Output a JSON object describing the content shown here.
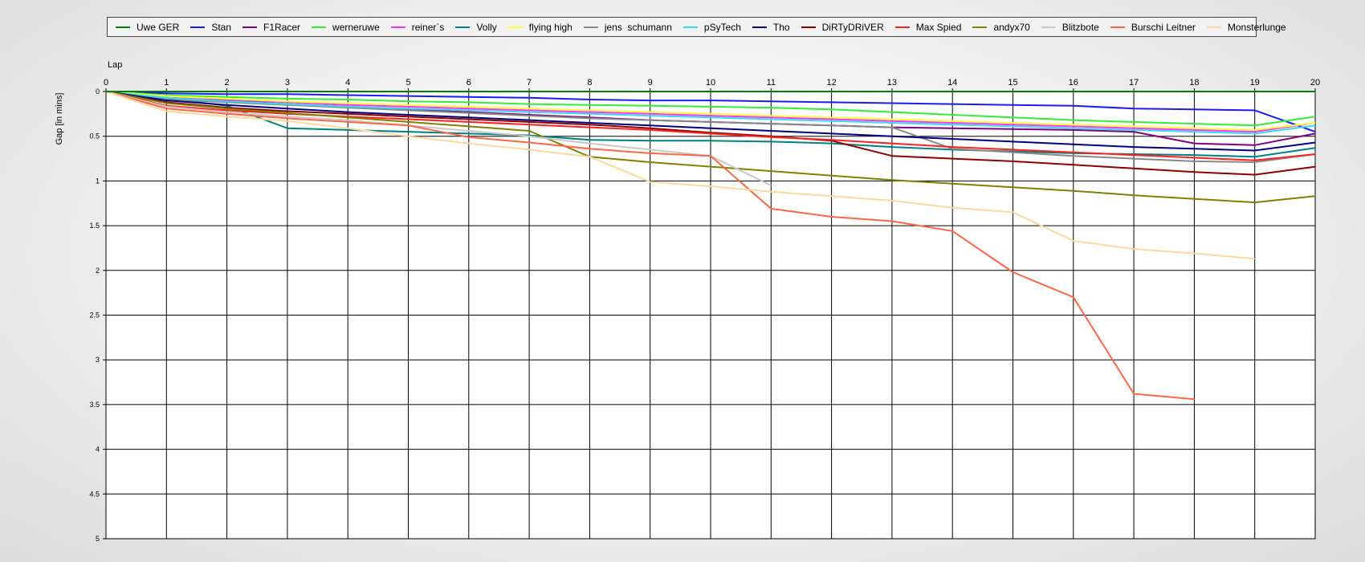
{
  "chart_data": {
    "type": "line",
    "xlabel": "Lap",
    "ylabel": "Gap [in mins]",
    "xlim": [
      0,
      20
    ],
    "ylim": [
      0,
      5
    ],
    "x_ticks": [
      "0",
      "1",
      "2",
      "3",
      "4",
      "5",
      "6",
      "7",
      "8",
      "9",
      "10",
      "11",
      "12",
      "13",
      "14",
      "15",
      "16",
      "17",
      "18",
      "19",
      "20"
    ],
    "y_ticks": [
      "0",
      "0.5",
      "1",
      "1.5",
      "2",
      "2.5",
      "3",
      "3.5",
      "4",
      "4.5",
      "5"
    ],
    "grid": true,
    "y_inverted": true,
    "legend_position": "top",
    "series": [
      {
        "name": "Uwe GER",
        "color": "#008000",
        "x": [
          0,
          1,
          2,
          3,
          4,
          5,
          6,
          7,
          8,
          9,
          10,
          11,
          12,
          13,
          14,
          15,
          16,
          17,
          18,
          19,
          20
        ],
        "values": [
          0,
          0,
          0,
          0,
          0,
          0,
          0,
          0,
          0,
          0,
          0,
          0,
          0,
          0,
          0,
          0,
          0,
          0,
          0,
          0,
          0
        ]
      },
      {
        "name": "Stan",
        "color": "#1a1aff",
        "x": [
          0,
          1,
          2,
          3,
          4,
          5,
          6,
          7,
          8,
          9,
          10,
          11,
          12,
          13,
          14,
          15,
          16,
          17,
          18,
          19,
          20
        ],
        "values": [
          0,
          0.02,
          0.03,
          0.03,
          0.04,
          0.05,
          0.06,
          0.07,
          0.09,
          0.1,
          0.1,
          0.11,
          0.12,
          0.13,
          0.14,
          0.15,
          0.16,
          0.19,
          0.2,
          0.21,
          0.45
        ]
      },
      {
        "name": "F1Racer",
        "color": "#800080",
        "x": [
          0,
          1,
          2,
          3,
          4,
          5,
          6,
          7,
          8,
          9,
          10,
          11,
          12,
          13,
          14,
          15,
          16,
          17,
          18,
          19,
          20
        ],
        "values": [
          0,
          0.05,
          0.1,
          0.14,
          0.17,
          0.2,
          0.23,
          0.26,
          0.29,
          0.32,
          0.34,
          0.36,
          0.38,
          0.4,
          0.41,
          0.42,
          0.43,
          0.45,
          0.58,
          0.6,
          0.47
        ]
      },
      {
        "name": "werneruwe",
        "color": "#33ee33",
        "x": [
          0,
          1,
          2,
          3,
          4,
          5,
          6,
          7,
          8,
          9,
          10,
          11,
          12,
          13,
          14,
          15,
          16,
          17,
          18,
          19,
          20
        ],
        "values": [
          0,
          0.04,
          0.06,
          0.08,
          0.09,
          0.11,
          0.12,
          0.14,
          0.15,
          0.16,
          0.17,
          0.18,
          0.2,
          0.23,
          0.26,
          0.29,
          0.32,
          0.34,
          0.36,
          0.38,
          0.28
        ]
      },
      {
        "name": "reiner`s",
        "color": "#ff33ff",
        "x": [
          0,
          1,
          2,
          3,
          4,
          5,
          6,
          7,
          8,
          9,
          10,
          11,
          12,
          13,
          14,
          15,
          16,
          17,
          18,
          19,
          20
        ],
        "values": [
          0,
          0.06,
          0.09,
          0.12,
          0.15,
          0.17,
          0.19,
          0.21,
          0.23,
          0.25,
          0.27,
          0.29,
          0.31,
          0.33,
          0.35,
          0.37,
          0.39,
          0.41,
          0.43,
          0.45,
          0.35
        ]
      },
      {
        "name": "Volly",
        "color": "#008080",
        "x": [
          0,
          1,
          2,
          3,
          4,
          5,
          6,
          7,
          8,
          9,
          10,
          11,
          12,
          13,
          14,
          15,
          16,
          17,
          18,
          19,
          20
        ],
        "values": [
          0,
          0.08,
          0.16,
          0.41,
          0.43,
          0.45,
          0.47,
          0.49,
          0.54,
          0.55,
          0.55,
          0.56,
          0.58,
          0.62,
          0.65,
          0.67,
          0.69,
          0.7,
          0.71,
          0.73,
          0.63
        ]
      },
      {
        "name": "flying high",
        "color": "#ffff33",
        "x": [
          0,
          1,
          2,
          3,
          4,
          5,
          6,
          7,
          8,
          9,
          10,
          11,
          12,
          13,
          14,
          15,
          16,
          17,
          18,
          19,
          20
        ],
        "values": [
          0,
          0.05,
          0.08,
          0.11,
          0.13,
          0.15,
          0.17,
          0.19,
          0.21,
          0.23,
          0.25,
          0.27,
          0.29,
          0.31,
          0.33,
          0.35,
          0.37,
          0.39,
          0.41,
          0.43,
          0.35
        ]
      },
      {
        "name": "jens  schumann",
        "color": "#888888",
        "x": [
          0,
          1,
          2,
          3,
          4,
          5,
          6,
          7,
          8,
          9,
          10,
          11,
          12,
          13,
          14,
          15,
          16,
          17,
          18,
          19,
          20
        ],
        "values": [
          0,
          0.09,
          0.12,
          0.15,
          0.18,
          0.21,
          0.24,
          0.27,
          0.3,
          0.32,
          0.34,
          0.36,
          0.38,
          0.4,
          0.64,
          0.68,
          0.72,
          0.75,
          0.78,
          0.79,
          0.7
        ]
      },
      {
        "name": "pSyTech",
        "color": "#33ddee",
        "x": [
          0,
          1,
          2,
          3,
          4,
          5,
          6,
          7,
          8,
          9,
          10,
          11,
          12,
          13,
          14,
          15,
          16,
          17,
          18,
          19,
          20
        ],
        "values": [
          0,
          0.07,
          0.11,
          0.14,
          0.17,
          0.19,
          0.21,
          0.23,
          0.25,
          0.27,
          0.29,
          0.31,
          0.33,
          0.35,
          0.37,
          0.39,
          0.41,
          0.43,
          0.45,
          0.47,
          0.38
        ]
      },
      {
        "name": "Tho",
        "color": "#000080",
        "x": [
          0,
          1,
          2,
          3,
          4,
          5,
          6,
          7,
          8,
          9,
          10,
          11,
          12,
          13,
          14,
          15,
          16,
          17,
          18,
          19,
          20
        ],
        "values": [
          0,
          0.1,
          0.15,
          0.19,
          0.23,
          0.26,
          0.29,
          0.32,
          0.35,
          0.38,
          0.41,
          0.44,
          0.47,
          0.5,
          0.53,
          0.56,
          0.59,
          0.62,
          0.64,
          0.66,
          0.57
        ]
      },
      {
        "name": "DiRTyDRiVER",
        "color": "#8b0000",
        "x": [
          0,
          1,
          2,
          3,
          4,
          5,
          6,
          7,
          8,
          9,
          10,
          11,
          12,
          13,
          14,
          15,
          16,
          17,
          18,
          19,
          20
        ],
        "values": [
          0,
          0.12,
          0.18,
          0.22,
          0.25,
          0.28,
          0.31,
          0.34,
          0.37,
          0.41,
          0.46,
          0.5,
          0.55,
          0.72,
          0.75,
          0.78,
          0.82,
          0.86,
          0.9,
          0.93,
          0.84
        ]
      },
      {
        "name": "Max Spied",
        "color": "#ff2020",
        "x": [
          0,
          1,
          2,
          3,
          4,
          5,
          6,
          7,
          8,
          9,
          10,
          11,
          12,
          13,
          14,
          15,
          16,
          17,
          18,
          19,
          20
        ],
        "values": [
          0,
          0.16,
          0.21,
          0.25,
          0.28,
          0.31,
          0.34,
          0.37,
          0.4,
          0.43,
          0.47,
          0.51,
          0.54,
          0.58,
          0.62,
          0.65,
          0.68,
          0.71,
          0.74,
          0.77,
          0.7
        ]
      },
      {
        "name": "andyx70",
        "color": "#808000",
        "x": [
          0,
          1,
          2,
          3,
          4,
          5,
          6,
          7,
          8,
          9,
          10,
          11,
          12,
          13,
          14,
          15,
          16,
          17,
          18,
          19,
          20
        ],
        "values": [
          0,
          0.13,
          0.19,
          0.24,
          0.29,
          0.34,
          0.39,
          0.44,
          0.73,
          0.79,
          0.84,
          0.89,
          0.94,
          0.99,
          1.03,
          1.07,
          1.11,
          1.16,
          1.2,
          1.24,
          1.17
        ]
      },
      {
        "name": "Blitzbote",
        "color": "#c8c8c8",
        "x": [
          0,
          1,
          2,
          3,
          4,
          5,
          6,
          7,
          8,
          9,
          10,
          11
        ],
        "values": [
          0,
          0.17,
          0.23,
          0.28,
          0.32,
          0.38,
          0.44,
          0.5,
          0.58,
          0.65,
          0.72,
          1.05
        ]
      },
      {
        "name": "Burschi Leitner",
        "color": "#ff6644",
        "x": [
          0,
          1,
          2,
          3,
          4,
          5,
          6,
          7,
          8,
          9,
          10,
          11,
          12,
          13,
          14,
          15,
          16,
          17,
          18
        ],
        "values": [
          0,
          0.19,
          0.25,
          0.3,
          0.34,
          0.38,
          0.51,
          0.57,
          0.64,
          0.69,
          0.72,
          1.31,
          1.4,
          1.45,
          1.56,
          2.02,
          2.3,
          3.38,
          3.44
        ]
      },
      {
        "name": "Monsterlunge",
        "color": "#ffd8a0",
        "x": [
          0,
          1,
          2,
          3,
          4,
          5,
          6,
          7,
          8,
          9,
          10,
          11,
          12,
          13,
          14,
          15,
          16,
          17,
          18,
          19
        ],
        "values": [
          0,
          0.22,
          0.28,
          0.33,
          0.41,
          0.5,
          0.58,
          0.65,
          0.73,
          1.01,
          1.06,
          1.12,
          1.17,
          1.22,
          1.3,
          1.35,
          1.67,
          1.76,
          1.81,
          1.87
        ]
      }
    ]
  }
}
